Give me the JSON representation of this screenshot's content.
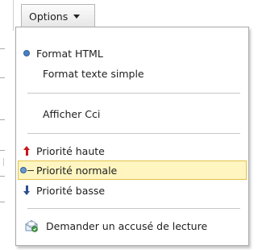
{
  "toolbar": {
    "options_label": "Options"
  },
  "menu": {
    "items": [
      {
        "label": "Format HTML",
        "icon": "radio-selected-icon",
        "selected": true
      },
      {
        "label": "Format texte simple",
        "icon": null
      },
      {
        "label": "Afficher Cci",
        "icon": null
      },
      {
        "label": "Priorité haute",
        "icon": "arrow-up-icon"
      },
      {
        "label": "Priorité normale",
        "icon": "normal-priority-icon",
        "selected": true,
        "highlighted": true
      },
      {
        "label": "Priorité basse",
        "icon": "arrow-down-icon"
      },
      {
        "label": "Demander un accusé de lecture",
        "icon": "read-receipt-icon"
      }
    ]
  },
  "colors": {
    "highlight_fill": "#fff5c0",
    "highlight_border": "#e2c247",
    "priority_high": "#c8161d",
    "priority_low": "#2d4f8e",
    "radio": "#4a7fc0"
  }
}
